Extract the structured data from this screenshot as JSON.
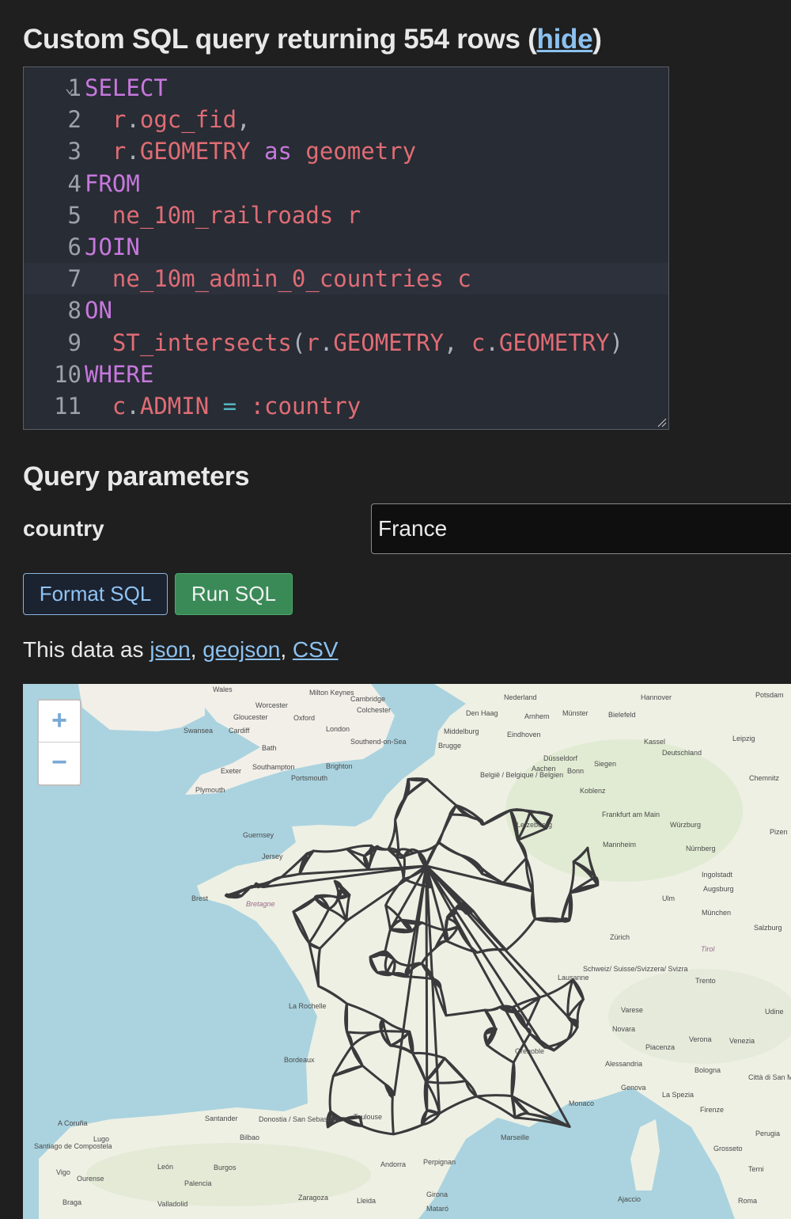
{
  "header": {
    "title_prefix": "Custom SQL query returning 554 rows (",
    "hide_link": "hide",
    "title_suffix": ")"
  },
  "editor": {
    "lines": [
      {
        "num": "1",
        "fold": "⌄",
        "tokens": [
          {
            "t": "SELECT",
            "c": "kw"
          }
        ]
      },
      {
        "num": "2",
        "tokens": [
          {
            "t": "  ",
            "c": "pu"
          },
          {
            "t": "r",
            "c": "id"
          },
          {
            "t": ".",
            "c": "pu"
          },
          {
            "t": "ogc_fid",
            "c": "id"
          },
          {
            "t": ",",
            "c": "pu"
          }
        ]
      },
      {
        "num": "3",
        "tokens": [
          {
            "t": "  ",
            "c": "pu"
          },
          {
            "t": "r",
            "c": "id"
          },
          {
            "t": ".",
            "c": "pu"
          },
          {
            "t": "GEOMETRY",
            "c": "id"
          },
          {
            "t": " ",
            "c": "pu"
          },
          {
            "t": "as",
            "c": "kw"
          },
          {
            "t": " ",
            "c": "pu"
          },
          {
            "t": "geometry",
            "c": "id"
          }
        ]
      },
      {
        "num": "4",
        "tokens": [
          {
            "t": "FROM",
            "c": "kw"
          }
        ]
      },
      {
        "num": "5",
        "tokens": [
          {
            "t": "  ",
            "c": "pu"
          },
          {
            "t": "ne_10m_railroads",
            "c": "id"
          },
          {
            "t": " ",
            "c": "pu"
          },
          {
            "t": "r",
            "c": "id"
          }
        ]
      },
      {
        "num": "6",
        "tokens": [
          {
            "t": "JOIN",
            "c": "kw"
          }
        ]
      },
      {
        "num": "7",
        "active": true,
        "tokens": [
          {
            "t": "  ",
            "c": "pu"
          },
          {
            "t": "ne_10m_admin_0_countries",
            "c": "id"
          },
          {
            "t": " ",
            "c": "pu"
          },
          {
            "t": "c",
            "c": "id"
          }
        ]
      },
      {
        "num": "8",
        "tokens": [
          {
            "t": "ON",
            "c": "kw"
          }
        ]
      },
      {
        "num": "9",
        "tokens": [
          {
            "t": "  ",
            "c": "pu"
          },
          {
            "t": "ST_intersects",
            "c": "id"
          },
          {
            "t": "(",
            "c": "pu"
          },
          {
            "t": "r",
            "c": "id"
          },
          {
            "t": ".",
            "c": "pu"
          },
          {
            "t": "GEOMETRY",
            "c": "id"
          },
          {
            "t": ", ",
            "c": "pu"
          },
          {
            "t": "c",
            "c": "id"
          },
          {
            "t": ".",
            "c": "pu"
          },
          {
            "t": "GEOMETRY",
            "c": "id"
          },
          {
            "t": ")",
            "c": "pu"
          }
        ]
      },
      {
        "num": "10",
        "tokens": [
          {
            "t": "WHERE",
            "c": "kw"
          }
        ]
      },
      {
        "num": "11",
        "tokens": [
          {
            "t": "  ",
            "c": "pu"
          },
          {
            "t": "c",
            "c": "id"
          },
          {
            "t": ".",
            "c": "pu"
          },
          {
            "t": "ADMIN",
            "c": "id"
          },
          {
            "t": " ",
            "c": "pu"
          },
          {
            "t": "=",
            "c": "op"
          },
          {
            "t": " ",
            "c": "pu"
          },
          {
            "t": ":country",
            "c": "id"
          }
        ]
      }
    ]
  },
  "params": {
    "title": "Query parameters",
    "country_label": "country",
    "country_value": "France"
  },
  "buttons": {
    "format": "Format SQL",
    "run": "Run SQL"
  },
  "export": {
    "prefix": "This data as ",
    "json": "json",
    "sep1": ", ",
    "geojson": "geojson",
    "sep2": ", ",
    "csv": "CSV"
  },
  "map": {
    "zoom_in": "+",
    "zoom_out": "−",
    "places": [
      "Wales",
      "Milton Keynes",
      "Cambridge",
      "Worcester",
      "Colchester",
      "Gloucester",
      "Oxford",
      "Swansea",
      "Cardiff",
      "London",
      "Southend-on-Sea",
      "Bath",
      "Exeter",
      "Southampton",
      "Brighton",
      "Portsmouth",
      "Plymouth",
      "Nederland",
      "Den Haag",
      "Middelburg",
      "Arnhem",
      "Münster",
      "Bielefeld",
      "Hannover",
      "Potsdam",
      "Eindhoven",
      "Kassel",
      "Leipzig",
      "Deutschland",
      "Düsseldorf",
      "Siegen",
      "Brugge",
      "België / Belgique / Belgien",
      "Aachen",
      "Bonn",
      "Koblenz",
      "Frankfurt am Main",
      "Würzburg",
      "Nürnberg",
      "Letzebuerg",
      "Mannheim",
      "Guernsey",
      "Jersey",
      "Brest",
      "Bretagne",
      "Ingolstadt",
      "Augsburg",
      "München",
      "Ulm",
      "Zürich",
      "Salzburg",
      "Schweiz/ Suisse/Svizzera/ Svizra",
      "Lausanne",
      "Varese",
      "Novara",
      "Verona",
      "Venezia",
      "Piacenza",
      "Bologna",
      "Genova",
      "La Spezia",
      "Firenze",
      "Città di San Marino",
      "Perugia",
      "Grosseto",
      "Alessandria",
      "Monaco",
      "La Rochelle",
      "Bordeaux",
      "Toulouse",
      "Marseille",
      "Grenoble",
      "Santander",
      "Donostia / San Sebastián",
      "Bilbao",
      "A Coruña",
      "Lugo",
      "Santiago de Compostela",
      "Vigo",
      "Ourense",
      "León",
      "Burgos",
      "Palencia",
      "Valladolid",
      "Braga",
      "Zaragoza",
      "Lleida",
      "Girona",
      "Mataró",
      "Andorra",
      "Perpignan",
      "Ajaccio",
      "Roma",
      "Udine",
      "Trento",
      "Terni",
      "Chemnitz",
      "Pizen",
      "Tirol"
    ]
  }
}
